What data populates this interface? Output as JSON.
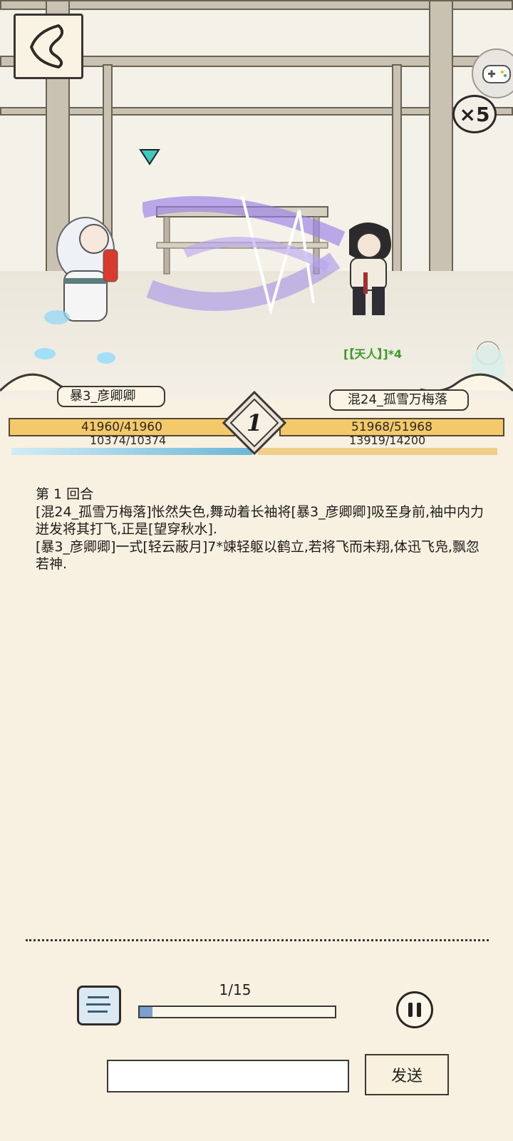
{
  "battle": {
    "round_number": "1",
    "speed_label": "×5",
    "enemy_buff": "[【天人】]*4"
  },
  "left_fighter": {
    "name": "暴3_彦卿卿",
    "hp_text": "41960/41960",
    "hp_ratio": 1.0,
    "mp_text": "10374/10374",
    "mp_ratio": 1.0
  },
  "right_fighter": {
    "name": "混24_孤雪万梅落",
    "hp_text": "51968/51968",
    "hp_ratio": 1.0,
    "mp_text": "13919/14200",
    "mp_ratio": 0.98
  },
  "log": {
    "lines": [
      "第 1 回合",
      "[混24_孤雪万梅落]怅然失色,舞动着长袖将[暴3_彦卿卿]吸至身前,袖中内力迸发将其打飞,正是[望穿秋水].",
      "[暴3_彦卿卿]一式[轻云蔽月]7*竦轻躯以鹤立,若将飞而未翔,体迅飞凫,飘忽若神."
    ]
  },
  "playback": {
    "progress_text": "1/15",
    "progress_ratio": 0.067
  },
  "chat": {
    "input_value": "",
    "send_label": "发送"
  },
  "colors": {
    "background": "#f8f1e2",
    "hp_fill": "#f4c96a",
    "mp_left": "#6bb7d6",
    "mp_right": "#f0cf8a",
    "progress_fill": "#7d9fcf",
    "buff_text": "#3e9a2a"
  }
}
